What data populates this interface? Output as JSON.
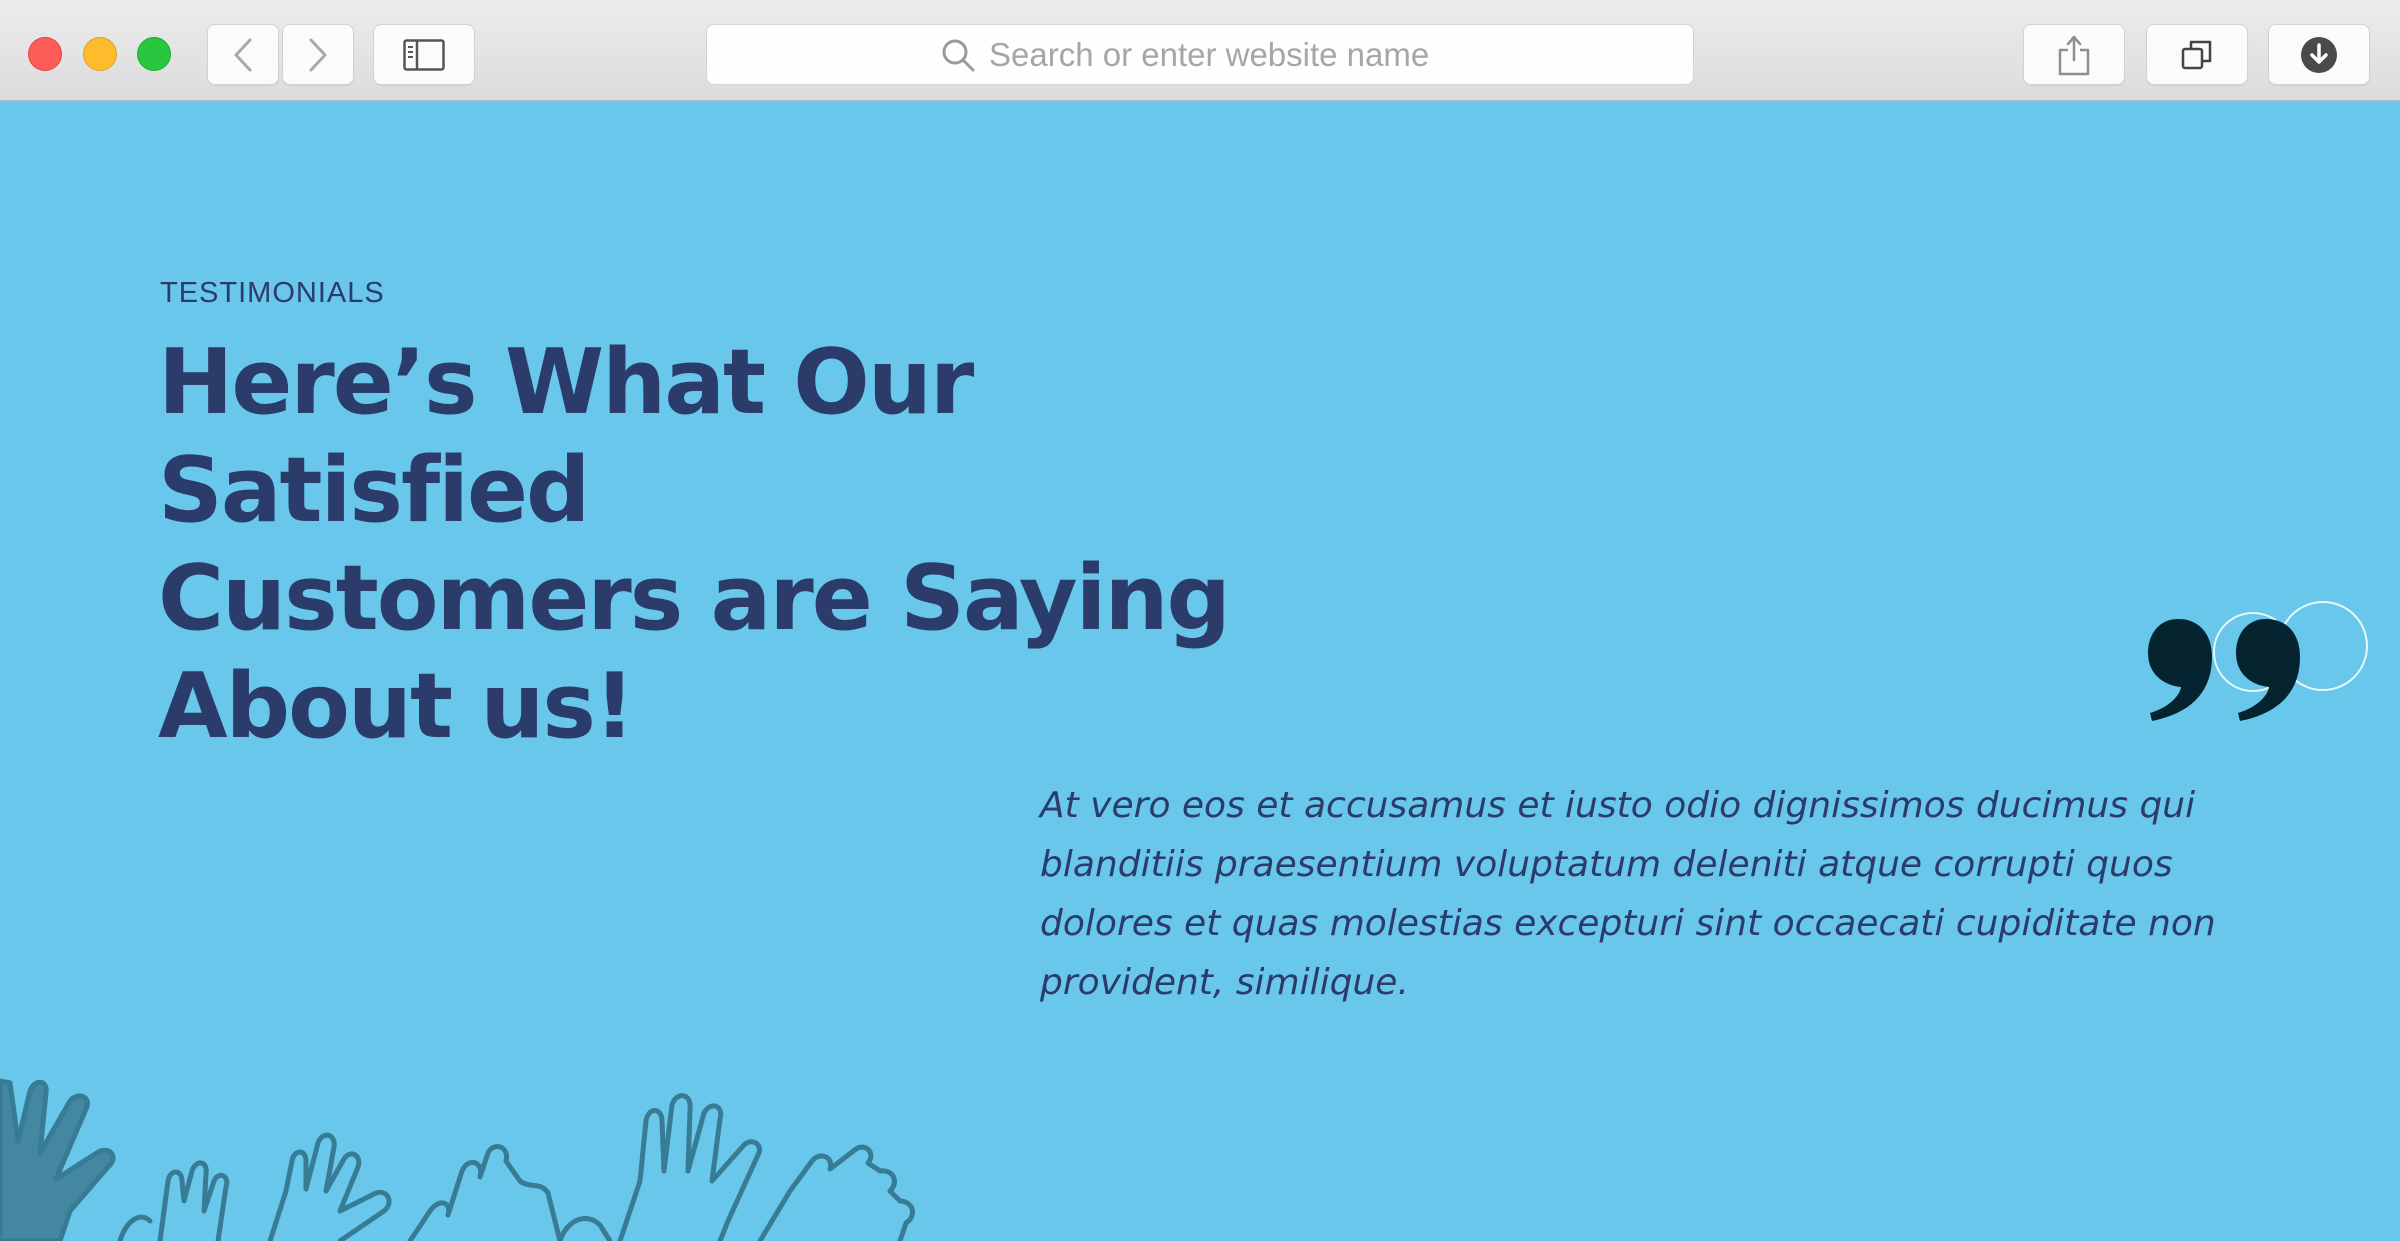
{
  "browser": {
    "address_placeholder": "Search or enter website name",
    "icons": {
      "back": "chevron-left-icon",
      "forward": "chevron-right-icon",
      "sidebar": "sidebar-icon",
      "search": "search-icon",
      "share": "share-icon",
      "tabs": "tabs-icon",
      "downloads": "download-icon"
    }
  },
  "testimonials": {
    "eyebrow": "TESTIMONIALS",
    "heading_lines": [
      "Here’s What Our Satisfied",
      "Customers are Saying",
      "About us!"
    ],
    "quote_lines": [
      "At vero eos et accusamus et iusto odio dignissimos ducimus qui",
      "blanditiis praesentium voluptatum deleniti atque corrupti quos",
      "dolores et quas molestias excepturi sint occaecati cupiditate non",
      "provident, similique."
    ]
  },
  "colors": {
    "page_background": "#68c7ea",
    "heading": "#2b3b6a",
    "quote_mark": "#062430",
    "hands_illustration": "#2f6f86"
  }
}
